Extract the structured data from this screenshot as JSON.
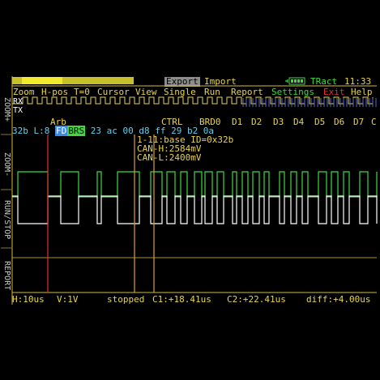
{
  "header": {
    "export_label": "Export",
    "import_label": "Import",
    "tract_label": "TRact",
    "clock": "11:33"
  },
  "menu": [
    "Zoom",
    "H-pos",
    "T=0",
    "Cursor",
    "View",
    "Single",
    "Run",
    "Report",
    "Settings",
    "Exit",
    "Help"
  ],
  "side_buttons": [
    "ZOOM+",
    "ZOOM-",
    "RUN/STOP",
    "REPORT"
  ],
  "channels": {
    "rx": "RX",
    "tx": "TX"
  },
  "field_labels": [
    "Arb",
    "CTRL",
    "BRD0",
    "D1",
    "D2",
    "D3",
    "D4",
    "D5",
    "D6",
    "D7",
    "C"
  ],
  "decode": {
    "prefix": "32b L:8",
    "fd": "FD",
    "brs": "BRS",
    "bytes": "23 ac 00 d8 ff 29 b2 0a"
  },
  "info": {
    "line1": "1-11:base ID=0x32b",
    "line2": "CAN-H:2584mV",
    "line3": "CAN-L:2400mV"
  },
  "status": {
    "hdiv": "H:10us",
    "vdiv": "V:1V",
    "state": "stopped",
    "c1": "C1:+18.41us",
    "c2": "C2:+22.41us",
    "diff": "diff:+4.00us"
  },
  "colors": {
    "accent_yellow": "#e8d44a",
    "can_h": "#3fd93f",
    "can_l": "#ffffff",
    "cursor": "#d9a420",
    "trigger": "#e03030",
    "fd_badge": "#3a8be8",
    "brs_badge": "#3fd93f",
    "exit": "#e03030",
    "settings": "#3fd93f"
  },
  "icons": [
    "battery-icon",
    "plug-icon"
  ]
}
